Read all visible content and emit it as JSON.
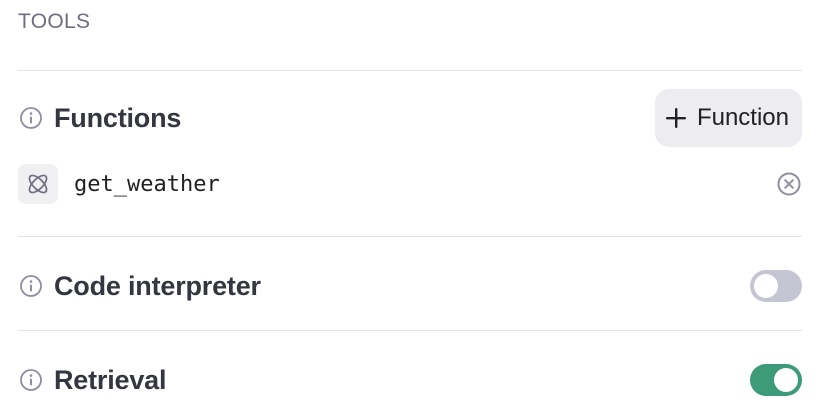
{
  "section": {
    "title": "TOOLS"
  },
  "functions": {
    "label": "Functions",
    "add_button_label": "Function",
    "items": [
      {
        "name": "get_weather"
      }
    ]
  },
  "code_interpreter": {
    "label": "Code interpreter",
    "enabled": false
  },
  "retrieval": {
    "label": "Retrieval",
    "enabled": true
  },
  "colors": {
    "toggle_on": "#3e9b7a",
    "toggle_off": "#c5c5d2",
    "muted_text": "#6e6e80"
  },
  "icons": {
    "info": "info-circle-icon",
    "add": "plus-icon",
    "function": "atom-icon",
    "remove": "close-circle-icon"
  }
}
